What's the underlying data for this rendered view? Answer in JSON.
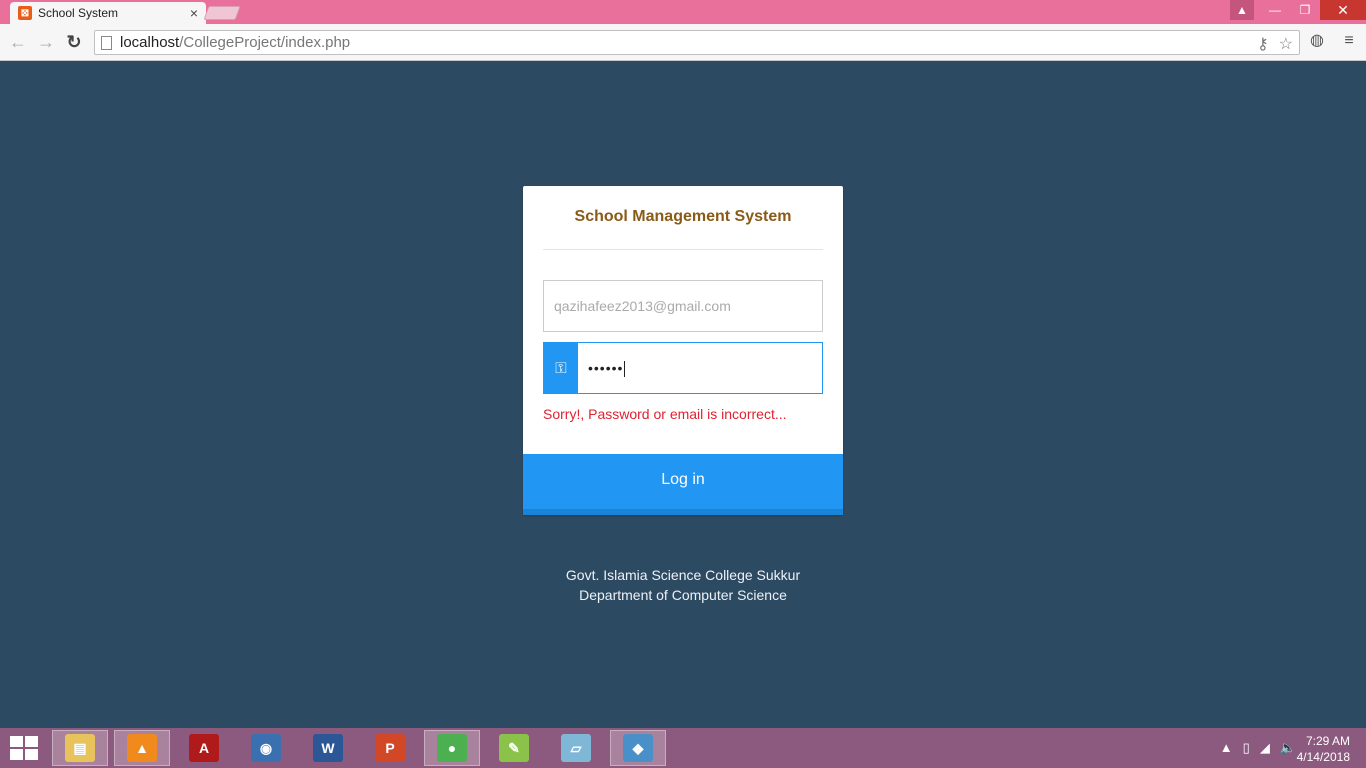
{
  "browser": {
    "tab_title": "School System",
    "tab_close": "×",
    "favicon_letter": "⊠",
    "url_host": "localhost",
    "url_path": "/CollegeProject/index.php"
  },
  "login": {
    "title": "School Management System",
    "email_value": "qazihafeez2013@gmail.com",
    "password_value": "••••••",
    "error": "Sorry!, Password or email is incorrect...",
    "button": "Log in"
  },
  "footer": {
    "line1": "Govt. Islamia Science College Sukkur",
    "line2": "Department of Computer Science"
  },
  "taskbar": {
    "apps": [
      {
        "name": "file-explorer-icon",
        "glyph": "▤",
        "color": "#e8c25a",
        "active": true
      },
      {
        "name": "vlc-icon",
        "glyph": "▲",
        "color": "#f08a1c",
        "active": true
      },
      {
        "name": "acrobat-icon",
        "glyph": "A",
        "color": "#b11a1a",
        "active": false
      },
      {
        "name": "media-player-icon",
        "glyph": "◉",
        "color": "#3a6fb0",
        "active": false
      },
      {
        "name": "word-icon",
        "glyph": "W",
        "color": "#2b5797",
        "active": false
      },
      {
        "name": "powerpoint-icon",
        "glyph": "P",
        "color": "#d24726",
        "active": false
      },
      {
        "name": "chrome-icon",
        "glyph": "●",
        "color": "#4caf50",
        "active": true
      },
      {
        "name": "notepadpp-icon",
        "glyph": "✎",
        "color": "#8bc34a",
        "active": false
      },
      {
        "name": "notebook-icon",
        "glyph": "▱",
        "color": "#7fb7d6",
        "active": false
      },
      {
        "name": "virtualbox-icon",
        "glyph": "◆",
        "color": "#4a90c8",
        "active": true
      }
    ],
    "time": "7:29 AM",
    "date": "4/14/2018"
  }
}
